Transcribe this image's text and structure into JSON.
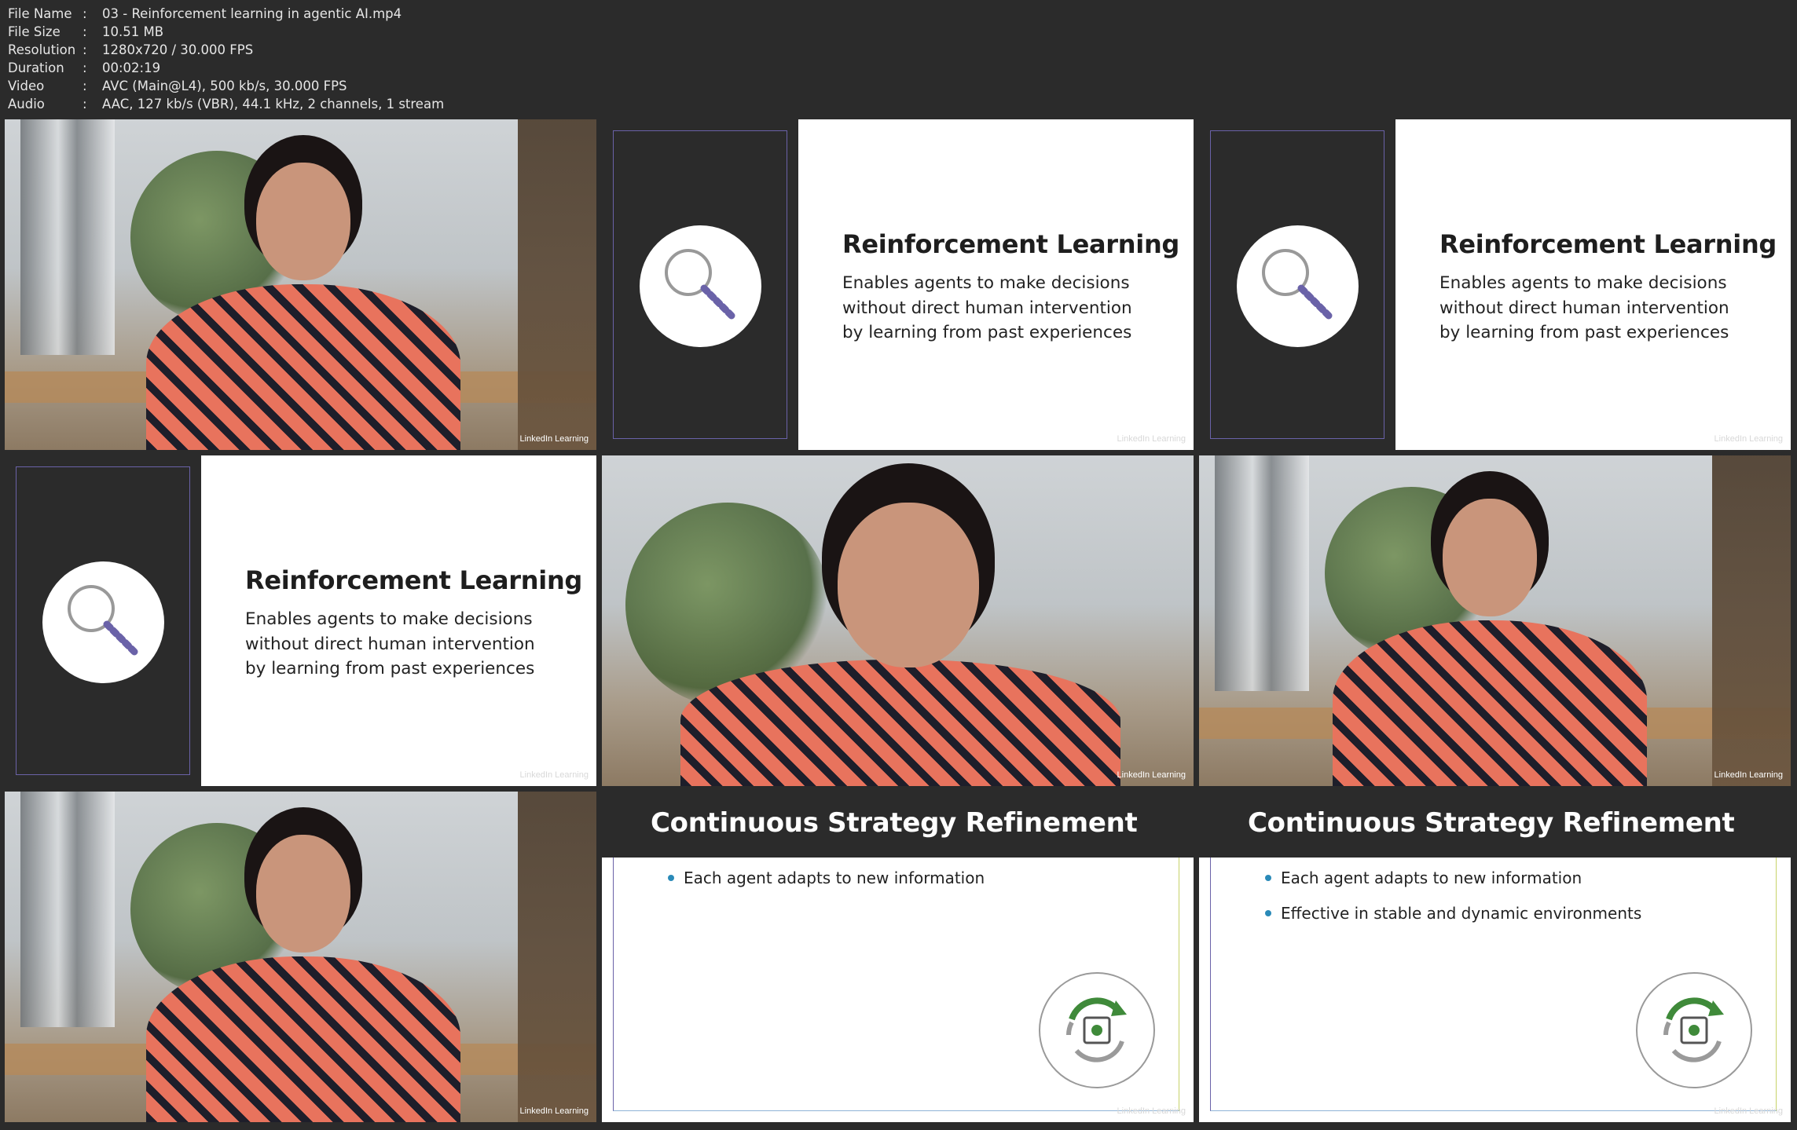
{
  "file_info": [
    {
      "key": "File Name",
      "value": "03 - Reinforcement learning in agentic AI.mp4"
    },
    {
      "key": "File Size",
      "value": "10.51 MB"
    },
    {
      "key": "Resolution",
      "value": "1280x720 / 30.000 FPS"
    },
    {
      "key": "Duration",
      "value": "00:02:19"
    },
    {
      "key": "Video",
      "value": "AVC (Main@L4), 500 kb/s, 30.000 FPS"
    },
    {
      "key": "Audio",
      "value": "AAC, 127 kb/s (VBR), 44.1 kHz, 2 channels, 1 stream"
    }
  ],
  "separator": ":",
  "watermark": "LinkedIn Learning",
  "rl_slide": {
    "title": "Reinforcement Learning",
    "lines": [
      "Enables agents to make decisions",
      "without direct human intervention",
      "by learning from past experiences"
    ]
  },
  "csr_slide": {
    "title": "Continuous Strategy Refinement",
    "bullets_a": [
      "Each agent adapts to new information"
    ],
    "bullets_b": [
      "Each agent adapts to new information",
      "Effective in stable and dynamic environments"
    ]
  },
  "icons": {
    "rl": "magnifier-icon",
    "csr": "cycle-chip-icon"
  },
  "colors": {
    "dark": "#2b2b2b",
    "accent_purple": "#6a62a8",
    "bullet_blue": "#2a8ab8",
    "arrow_green": "#3f8a3a"
  }
}
